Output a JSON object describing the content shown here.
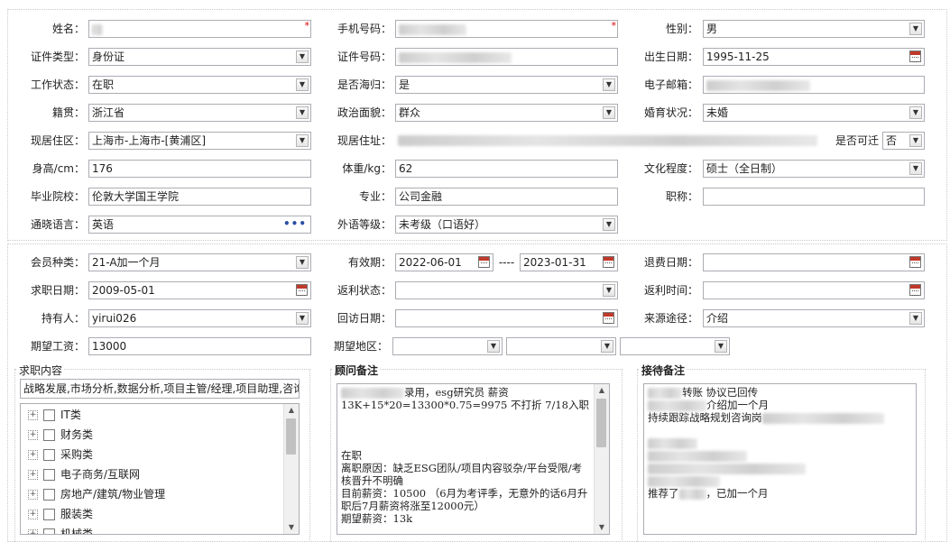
{
  "basic": {
    "name_label": "姓名：",
    "phone_label": "手机号码：",
    "gender_label": "性别：",
    "gender_value": "男",
    "id_type_label": "证件类型：",
    "id_type_value": "身份证",
    "id_no_label": "证件号码：",
    "birth_label": "出生日期：",
    "birth_value": "1995-11-25",
    "work_status_label": "工作状态：",
    "work_status_value": "在职",
    "overseas_label": "是否海归：",
    "overseas_value": "是",
    "email_label": "电子邮箱：",
    "native_label": "籍贯：",
    "native_value": "浙江省",
    "political_label": "政治面貌：",
    "political_value": "群众",
    "marital_label": "婚育状况：",
    "marital_value": "未婚",
    "region_label": "现居住区：",
    "region_value": "上海市-上海市-[黄浦区]",
    "address_label": "现居住址：",
    "relocate_label": "是否可迁",
    "relocate_value": "否",
    "height_label": "身高/cm：",
    "height_value": "176",
    "weight_label": "体重/kg：",
    "weight_value": "62",
    "education_label": "文化程度：",
    "education_value": "硕士（全日制）",
    "school_label": "毕业院校：",
    "school_value": "伦敦大学国王学院",
    "major_label": "专业：",
    "major_value": "公司金融",
    "title_label": "职称：",
    "language_label": "通晓语言：",
    "language_value": "英语",
    "foreign_level_label": "外语等级：",
    "foreign_level_value": "未考级（口语好）"
  },
  "member": {
    "type_label": "会员种类：",
    "type_value": "21-A加一个月",
    "valid_label": "有效期：",
    "valid_from": "2022-06-01",
    "valid_sep": "----",
    "valid_to": "2023-01-31",
    "refund_date_label": "退费日期：",
    "job_date_label": "求职日期：",
    "job_date_value": "2009-05-01",
    "rebate_status_label": "返利状态：",
    "rebate_time_label": "返利时间：",
    "holder_label": "持有人：",
    "holder_value": "yirui026",
    "visit_date_label": "回访日期：",
    "source_label": "来源途径：",
    "source_value": "介绍",
    "salary_label": "期望工资：",
    "salary_value": "13000",
    "area_label": "期望地区："
  },
  "job_content": {
    "title": "求职内容",
    "summary": "战略发展,市场分析,数据分析,项目主管/经理,项目助理,咨询",
    "categories": [
      "IT类",
      "财务类",
      "采购类",
      "电子商务/互联网",
      "房地产/建筑/物业管理",
      "服装类",
      "机械类"
    ]
  },
  "advisor_notes": {
    "title": "顾问备注",
    "lines": [
      "录用，esg研究员   薪资",
      "13K+15*20=13300*0.75=9975 不打折   7/18入职",
      "",
      "",
      "",
      "在职",
      "离职原因：缺乏ESG团队/项目内容驳杂/平台受限/考",
      "核晋升不明确",
      "目前薪资：10500 （6月为考评季，无意外的话6月升",
      "职后7月薪资将涨至12000元）",
      "期望薪资：13k"
    ]
  },
  "reception_notes": {
    "title": "接待备注",
    "lines": [
      "转账  协议已回传",
      "介绍加一个月",
      "持续跟踪战略规划咨询岗",
      "",
      "",
      "",
      "",
      "",
      "推荐了",
      "，已加一个月"
    ]
  },
  "icons": {
    "dropdown": "chevron-down-icon",
    "calendar": "calendar-icon",
    "more": "ellipsis-icon",
    "required": "asterisk-icon"
  },
  "colors": {
    "required": "#dd0000",
    "calendar_header": "#c0392b",
    "border": "#abadb3"
  }
}
